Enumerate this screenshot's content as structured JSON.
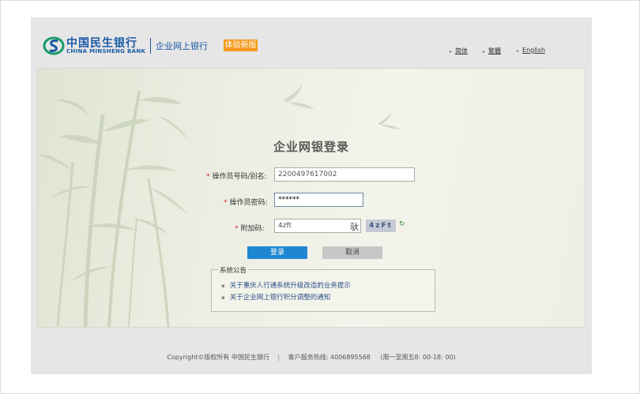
{
  "header": {
    "logo_cn": "中国民生银行",
    "logo_en": "CHINA MINSHENG BANK",
    "subtitle": "企业网上银行",
    "badge": "体验新版",
    "languages": [
      "简体",
      "繁體",
      "English"
    ]
  },
  "login": {
    "title": "企业网银登录",
    "operator_label": "操作员号码/别名:",
    "operator_value": "2200497617002",
    "password_label": "操作员密码:",
    "password_value": "******",
    "captcha_label": "附加码:",
    "captcha_value": "4zft",
    "captcha_icon": "驮",
    "captcha_text": "4zFt",
    "required_mark": "*",
    "login_button": "登录",
    "cancel_button": "取消"
  },
  "notice": {
    "title": "系统公告",
    "items": [
      "关于重庆人行通系统升级改造的业务提示",
      "关于企业网上银行积分调整的通知"
    ]
  },
  "footer": {
    "copyright": "Copyright©版权所有 中国民生银行",
    "separator": "|",
    "hotline": "客户服务热线: 4006895568",
    "hours": "(周一至周五8: 00-18: 00)"
  },
  "colors": {
    "brand_blue": "#1b5ba6",
    "badge_orange": "#f39a1b",
    "button_blue": "#1d87d1",
    "required_red": "#d02a2a"
  }
}
